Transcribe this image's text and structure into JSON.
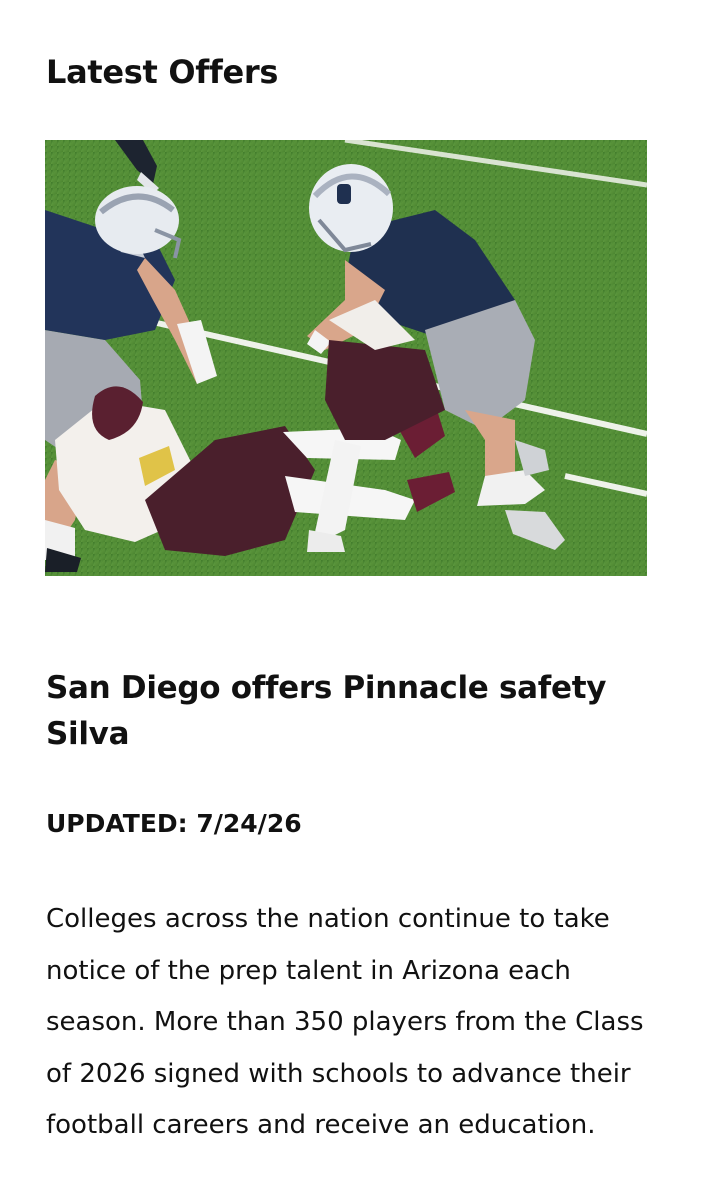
{
  "section": {
    "title": "Latest Offers"
  },
  "article": {
    "image_icon": "football-tackle-photo",
    "headline": "San Diego offers Pinnacle safety Silva",
    "updated_label": "UPDATED: 7/24/26",
    "body": "Colleges across the nation continue to take notice of the prep talent in Arizona each season. More than 350 players from the Class of 2026 signed with schools to advance their football careers and receive an education."
  },
  "colors": {
    "text": "#111111",
    "background": "#ffffff",
    "field_green": "#4f8a34",
    "navy_jersey": "#1f3050",
    "maroon_pants": "#4a1f2c"
  }
}
